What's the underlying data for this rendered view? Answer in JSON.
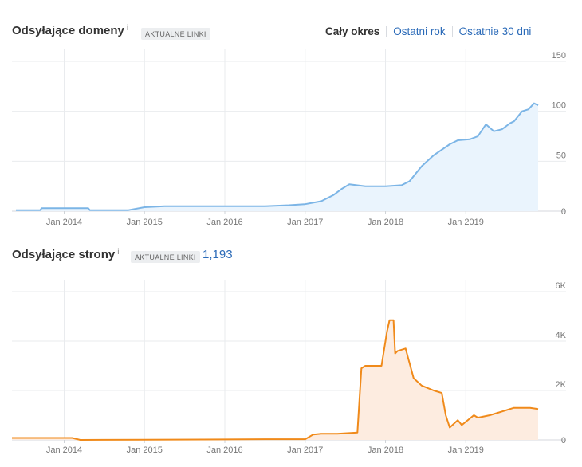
{
  "header": {
    "title": "Odsyłające domeny",
    "info_mark": "i",
    "badge": "AKTUALNE LINKI",
    "tabs": [
      {
        "label": "Cały okres",
        "active": true
      },
      {
        "label": "Ostatni rok",
        "active": false
      },
      {
        "label": "Ostatnie 30 dni",
        "active": false
      }
    ]
  },
  "section2": {
    "title": "Odsyłające strony",
    "info_mark": "i",
    "badge": "AKTUALNE LINKI",
    "count": "1,193"
  },
  "chart_data": [
    {
      "type": "area",
      "name": "Odsyłające domeny",
      "color": "#7cb5e6",
      "fill": "#eaf4fd",
      "x_unit": "year",
      "xlim": [
        2013.35,
        2019.95
      ],
      "ylim": [
        0,
        150
      ],
      "grid": true,
      "x_ticks": [
        {
          "v": 2014,
          "label": "Jan 2014"
        },
        {
          "v": 2015,
          "label": "Jan 2015"
        },
        {
          "v": 2016,
          "label": "Jan 2016"
        },
        {
          "v": 2017,
          "label": "Jan 2017"
        },
        {
          "v": 2018,
          "label": "Jan 2018"
        },
        {
          "v": 2019,
          "label": "Jan 2019"
        }
      ],
      "y_ticks": [
        {
          "v": 0,
          "label": "0"
        },
        {
          "v": 50,
          "label": "50"
        },
        {
          "v": 100,
          "label": "100"
        },
        {
          "v": 150,
          "label": "150"
        }
      ],
      "x": [
        2013.4,
        2013.7,
        2013.72,
        2014.3,
        2014.32,
        2014.8,
        2015.0,
        2015.25,
        2016.0,
        2016.5,
        2016.8,
        2017.0,
        2017.2,
        2017.35,
        2017.45,
        2017.55,
        2017.75,
        2018.0,
        2018.2,
        2018.3,
        2018.45,
        2018.6,
        2018.8,
        2018.9,
        2019.05,
        2019.15,
        2019.25,
        2019.35,
        2019.45,
        2019.55,
        2019.6,
        2019.7,
        2019.78,
        2019.85,
        2019.9
      ],
      "y": [
        1,
        1,
        3,
        3,
        1,
        1,
        4,
        5,
        5,
        5,
        6,
        7,
        10,
        16,
        22,
        27,
        25,
        25,
        26,
        30,
        45,
        56,
        67,
        71,
        72,
        75,
        87,
        80,
        82,
        88,
        90,
        100,
        102,
        108,
        106
      ]
    },
    {
      "type": "area",
      "name": "Odsyłające strony",
      "color": "#f08a1a",
      "fill": "#fdece0",
      "x_unit": "year",
      "xlim": [
        2013.35,
        2019.95
      ],
      "ylim": [
        0,
        6000
      ],
      "grid": true,
      "x_ticks": [
        {
          "v": 2014,
          "label": "Jan 2014"
        },
        {
          "v": 2015,
          "label": "Jan 2015"
        },
        {
          "v": 2016,
          "label": "Jan 2016"
        },
        {
          "v": 2017,
          "label": "Jan 2017"
        },
        {
          "v": 2018,
          "label": "Jan 2018"
        },
        {
          "v": 2019,
          "label": "Jan 2019"
        }
      ],
      "y_ticks": [
        {
          "v": 0,
          "label": "0"
        },
        {
          "v": 2000,
          "label": "2K"
        },
        {
          "v": 4000,
          "label": "4K"
        },
        {
          "v": 6000,
          "label": "6K"
        }
      ],
      "x": [
        2013.35,
        2014.1,
        2014.2,
        2015.0,
        2016.0,
        2016.5,
        2017.0,
        2017.1,
        2017.2,
        2017.4,
        2017.65,
        2017.7,
        2017.75,
        2017.95,
        2018.02,
        2018.05,
        2018.1,
        2018.12,
        2018.15,
        2018.25,
        2018.35,
        2018.45,
        2018.6,
        2018.7,
        2018.75,
        2018.8,
        2018.9,
        2018.95,
        2019.1,
        2019.15,
        2019.3,
        2019.5,
        2019.6,
        2019.7,
        2019.8,
        2019.9
      ],
      "y": [
        80,
        80,
        0,
        10,
        20,
        30,
        30,
        220,
        250,
        250,
        300,
        2900,
        3000,
        3000,
        4400,
        4850,
        4850,
        3500,
        3600,
        3700,
        2500,
        2200,
        2000,
        1900,
        1000,
        500,
        800,
        600,
        1000,
        900,
        1000,
        1200,
        1300,
        1300,
        1300,
        1250
      ]
    }
  ]
}
